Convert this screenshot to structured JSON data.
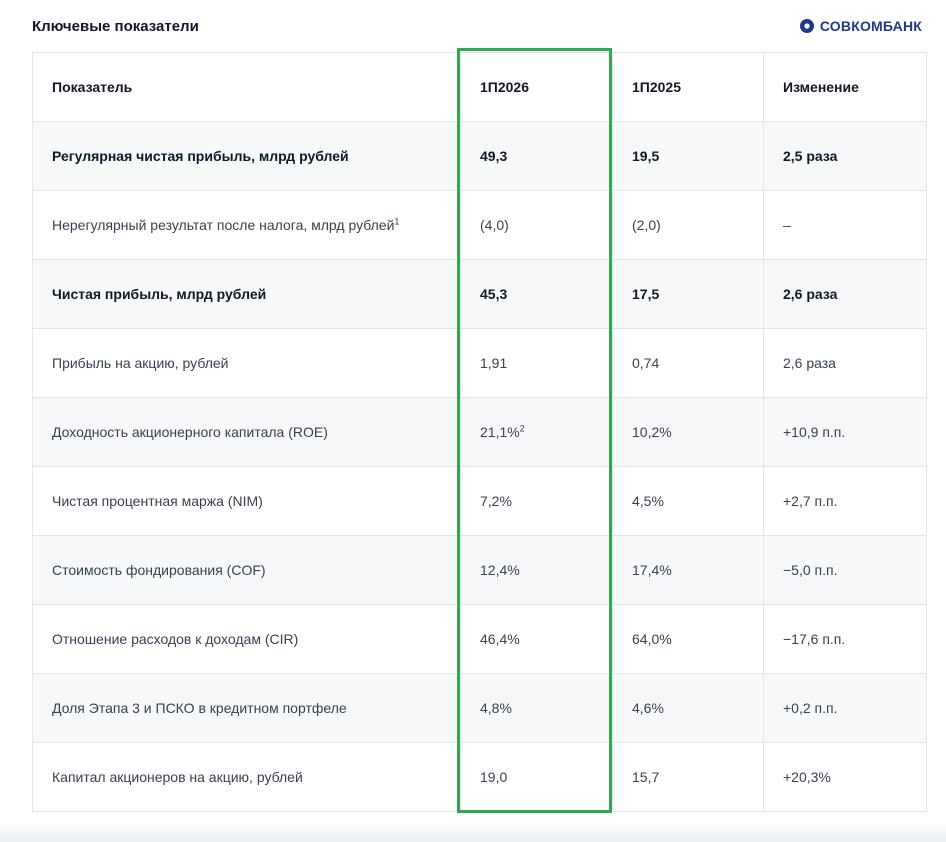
{
  "title": "Ключевые показатели",
  "logo": {
    "text": "СОВКОМБАНК",
    "colors": {
      "red": "#e31e24",
      "blue": "#1e3a8a"
    }
  },
  "table": {
    "headers": [
      "Показатель",
      "1П2026",
      "1П2025",
      "Изменение"
    ],
    "rows": [
      {
        "label": "Регулярная чистая прибыль, млрд рублей",
        "label_sup": "",
        "v2026": "49,3",
        "v2026_sup": "",
        "v2025": "19,5",
        "change": "2,5 раза"
      },
      {
        "label": "Нерегулярный результат после налога, млрд рублей",
        "label_sup": "1",
        "v2026": "(4,0)",
        "v2026_sup": "",
        "v2025": "(2,0)",
        "change": "–"
      },
      {
        "label": "Чистая прибыль, млрд рублей",
        "label_sup": "",
        "v2026": "45,3",
        "v2026_sup": "",
        "v2025": "17,5",
        "change": "2,6 раза"
      },
      {
        "label": "Прибыль на акцию, рублей",
        "label_sup": "",
        "v2026": "1,91",
        "v2026_sup": "",
        "v2025": "0,74",
        "change": "2,6 раза"
      },
      {
        "label": "Доходность акционерного капитала (ROE)",
        "label_sup": "",
        "v2026": "21,1%",
        "v2026_sup": "2",
        "v2025": "10,2%",
        "change": "+10,9 п.п."
      },
      {
        "label": "Чистая процентная маржа (NIM)",
        "label_sup": "",
        "v2026": "7,2%",
        "v2026_sup": "",
        "v2025": "4,5%",
        "change": "+2,7 п.п."
      },
      {
        "label": "Стоимость фондирования (COF)",
        "label_sup": "",
        "v2026": "12,4%",
        "v2026_sup": "",
        "v2025": "17,4%",
        "change": "−5,0 п.п."
      },
      {
        "label": "Отношение расходов к доходам (CIR)",
        "label_sup": "",
        "v2026": "46,4%",
        "v2026_sup": "",
        "v2025": "64,0%",
        "change": "−17,6 п.п."
      },
      {
        "label": "Доля Этапа 3 и ПСКО в кредитном портфеле",
        "label_sup": "",
        "v2026": "4,8%",
        "v2026_sup": "",
        "v2025": "4,6%",
        "change": "+0,2 п.п."
      },
      {
        "label": "Капитал акционеров на акцию, рублей",
        "label_sup": "",
        "v2026": "19,0",
        "v2026_sup": "",
        "v2025": "15,7",
        "change": "+20,3%"
      }
    ]
  },
  "highlight_color": "#2fa84f"
}
